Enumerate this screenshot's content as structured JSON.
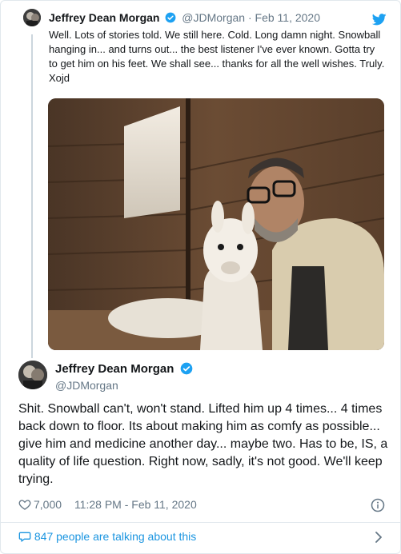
{
  "quoted_tweet": {
    "name": "Jeffrey Dean Morgan",
    "handle": "@JDMorgan",
    "separator": "·",
    "date": "Feb 11, 2020",
    "text": "Well. Lots of stories told. We still here. Cold. Long damn night. Snowball hanging in... and turns out... the best listener I've ever known. Gotta try to get him on his feet. We shall see... thanks for all the well wishes. Truly. Xojd",
    "icons": {
      "verified": "verified-badge-icon",
      "brand": "twitter-bird-icon"
    }
  },
  "main_tweet": {
    "name": "Jeffrey Dean Morgan",
    "handle": "@JDMorgan",
    "text": "Shit. Snowball can't, won't stand. Lifted him up 4 times... 4 times back down to floor. Its about making him as comfy as possible... give him and medicine another day... maybe two.  Has to be, IS, a quality of life question. Right now, sadly, it's not good. We'll keep trying.",
    "likes": "7,000",
    "timestamp": "11:28 PM - Feb 11, 2020",
    "talking": "847 people are talking about this"
  },
  "colors": {
    "accent": "#1da1f2",
    "link": "#1b95e0",
    "muted": "#657786",
    "text": "#14171a",
    "border": "#e1e8ed"
  }
}
